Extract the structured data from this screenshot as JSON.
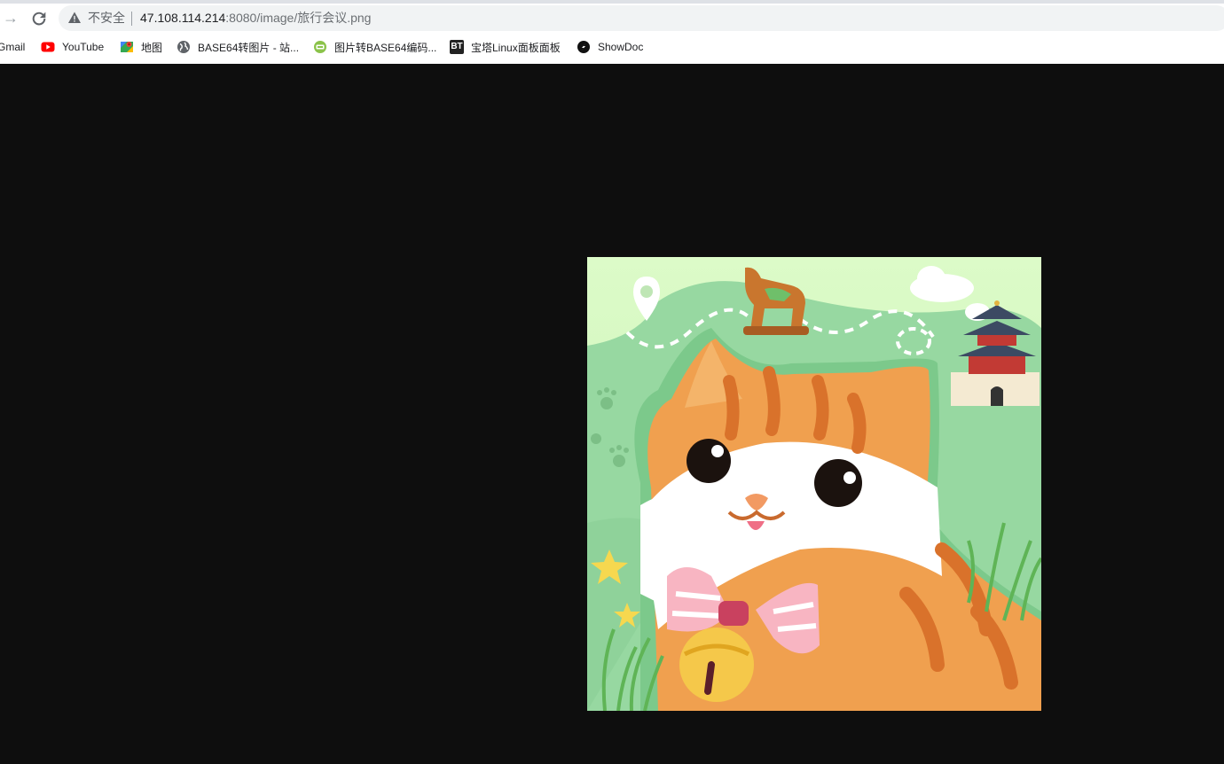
{
  "browser": {
    "address_bar": {
      "security_label": "不安全",
      "url_host": "47.108.114.214",
      "url_path": ":8080/image/旅行会议.png"
    },
    "bookmarks": [
      {
        "label": "Gmail",
        "icon": "gmail-icon"
      },
      {
        "label": "YouTube",
        "icon": "youtube-icon"
      },
      {
        "label": "地图",
        "icon": "maps-icon"
      },
      {
        "label": "BASE64转图片 - 站...",
        "icon": "globe-icon"
      },
      {
        "label": "图片转BASE64编码...",
        "icon": "base64-icon"
      },
      {
        "label": "宝塔Linux面板面板",
        "icon": "bt-icon"
      },
      {
        "label": "ShowDoc",
        "icon": "showdoc-icon"
      }
    ],
    "bt_icon_text": "BT"
  },
  "viewer": {
    "background_color": "#0e0e0e",
    "image_description_icon": "cat-travel-illustration"
  }
}
